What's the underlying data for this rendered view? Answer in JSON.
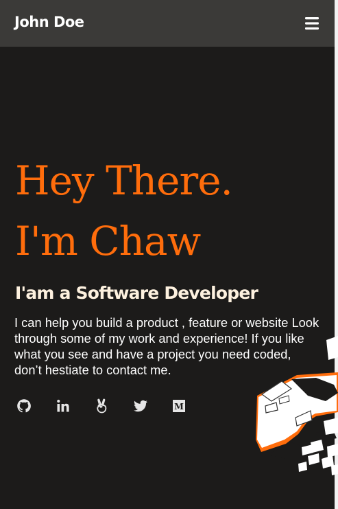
{
  "header": {
    "brand": "John Doe"
  },
  "hero": {
    "line1": "Hey There.",
    "line2": "I'm Chaw",
    "subtitle": "I'am a Software Developer",
    "bio": "I can help you build a product , feature or website Look through some of my work and experience! If you like what you see and have a project you need coded, don’t hestiate to contact me."
  },
  "social": {
    "medium_glyph": "M"
  },
  "colors": {
    "background": "#1c1b1a",
    "navbar": "#3b3a38",
    "accent": "#ff6d0c",
    "subtitle": "#fdf1df",
    "text": "#ffffff",
    "icon": "#e6e6e6"
  },
  "icons": [
    "menu-icon",
    "github-icon",
    "linkedin-icon",
    "angellist-icon",
    "twitter-icon",
    "medium-icon"
  ]
}
